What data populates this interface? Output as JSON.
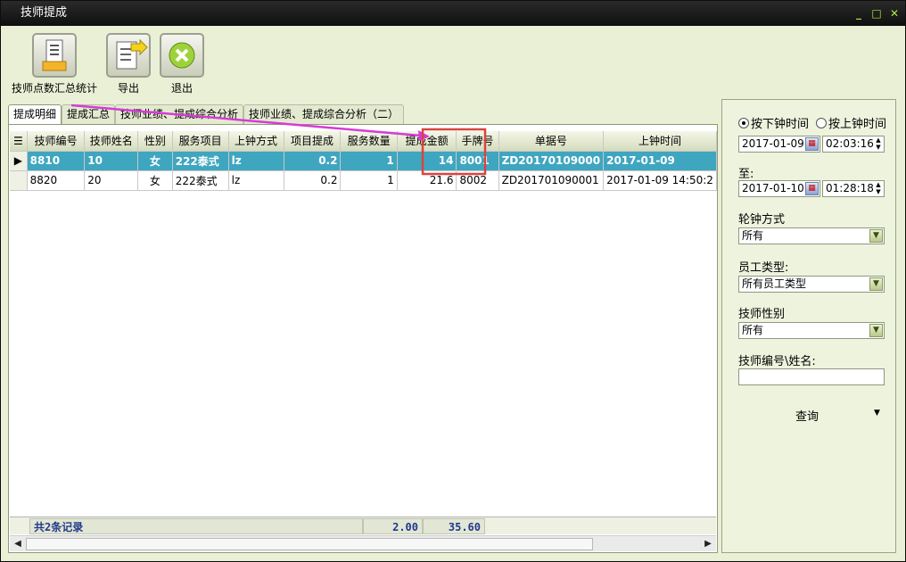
{
  "window": {
    "title": "技师提成"
  },
  "toolbar": {
    "stats_label": "技师点数汇总统计",
    "export_label": "导出",
    "exit_label": "退出"
  },
  "tabs": [
    {
      "label": "提成明细",
      "active": true
    },
    {
      "label": "提成汇总"
    },
    {
      "label": "技师业绩、提成综合分析"
    },
    {
      "label": "技师业绩、提成综合分析（二）"
    }
  ],
  "grid": {
    "columns": [
      "技师编号",
      "技师姓名",
      "性别",
      "服务项目",
      "上钟方式",
      "项目提成",
      "服务数量",
      "提成金额",
      "手牌号",
      "单据号",
      "上钟时间"
    ],
    "rows": [
      [
        "8810",
        "10",
        "女",
        "222泰式",
        "lz",
        "0.2",
        "1",
        "14",
        "8001",
        "ZD20170109000",
        "2017-01-09"
      ],
      [
        "8820",
        "20",
        "女",
        "222泰式",
        "lz",
        "0.2",
        "1",
        "21.6",
        "8002",
        "ZD201701090001",
        "2017-01-09 14:50:2"
      ]
    ],
    "footer": {
      "record_count": "共2条记录",
      "qty_total": "2.00",
      "amount_total": "35.60"
    }
  },
  "filters": {
    "radio_checkout": "按下钟时间",
    "radio_checkin": "按上钟时间",
    "from_date": "2017-01-09",
    "from_time": "02:03:16",
    "to_label": "至:",
    "to_date": "2017-01-10",
    "to_time": "01:28:18",
    "rotation_label": "轮钟方式",
    "rotation_value": "所有",
    "staff_type_label": "员工类型:",
    "staff_type_value": "所有员工类型",
    "gender_label": "技师性别",
    "gender_value": "所有",
    "tech_id_label": "技师编号\\姓名:",
    "tech_id_value": "",
    "query_label": "查询"
  },
  "colors": {
    "highlight_box": "#d9443f",
    "arrow": "#d63bd6",
    "selected_row": "#3fa6c0"
  }
}
